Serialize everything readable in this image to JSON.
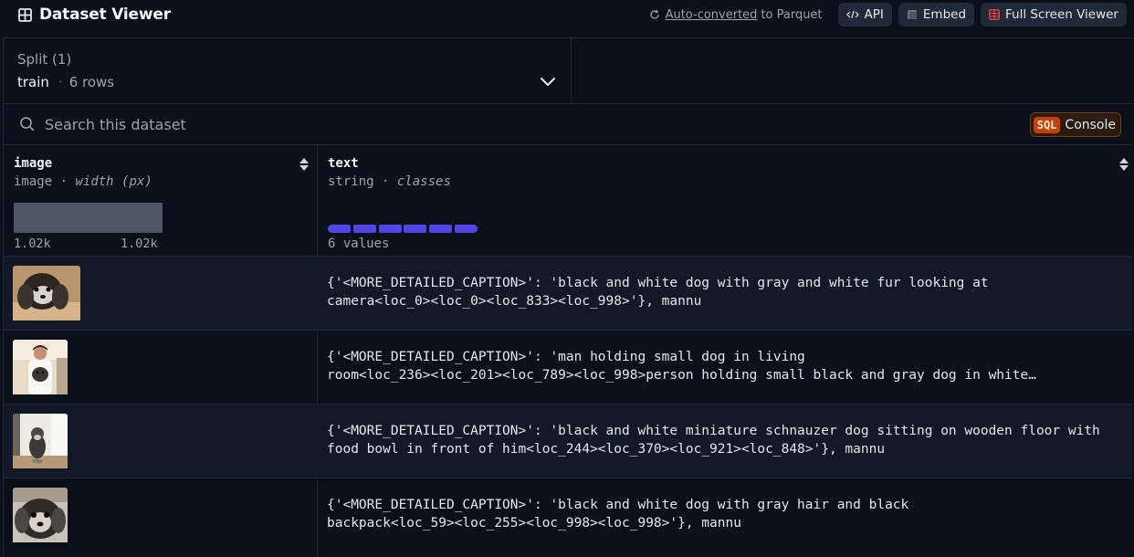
{
  "header": {
    "title": "Dataset Viewer",
    "auto_converted_link": "Auto-converted",
    "parquet_suffix": "to Parquet",
    "api_label": "API",
    "embed_label": "Embed",
    "fullscreen_label": "Full Screen Viewer"
  },
  "split": {
    "label": "Split (1)",
    "value": "train",
    "dot": "·",
    "rows": "6 rows"
  },
  "search": {
    "placeholder": "Search this dataset",
    "sql_tag": "SQL",
    "console_label": "Console"
  },
  "columns": [
    {
      "name": "image",
      "type": "image",
      "sep": "·",
      "stat": "width (px)",
      "hist_min": "1.02k",
      "hist_max": "1.02k"
    },
    {
      "name": "text",
      "type": "string",
      "sep": "·",
      "stat": "classes",
      "values_label": "6 values",
      "class_count": 6
    }
  ],
  "rows": [
    {
      "image_icon": "dog-photo-thumbnail",
      "text_line1": "{'<MORE_DETAILED_CAPTION>': 'black and white dog with gray and white fur looking at",
      "text_line2": "camera<loc_0><loc_0><loc_833><loc_998>'}, mannu"
    },
    {
      "image_icon": "man-with-dog-photo-thumbnail",
      "text_line1": "{'<MORE_DETAILED_CAPTION>': 'man holding small dog in living",
      "text_line2": "room<loc_236><loc_201><loc_789><loc_998>person holding small black and gray dog in white…"
    },
    {
      "image_icon": "schnauzer-photo-thumbnail",
      "text_line1": "{'<MORE_DETAILED_CAPTION>': 'black and white miniature schnauzer dog sitting on wooden floor with",
      "text_line2": "food bowl in front of him<loc_244><loc_370><loc_921><loc_848>'}, mannu"
    },
    {
      "image_icon": "dog-closeup-photo-thumbnail",
      "text_line1": "{'<MORE_DETAILED_CAPTION>': 'black and white dog with gray hair and black",
      "text_line2": "backpack<loc_59><loc_255><loc_998><loc_998>'}, mannu"
    }
  ],
  "colors": {
    "background": "#0b0f19",
    "row_alt": "#111827",
    "class_bar": "#4f46e5",
    "sql_accent": "#c2410c"
  }
}
